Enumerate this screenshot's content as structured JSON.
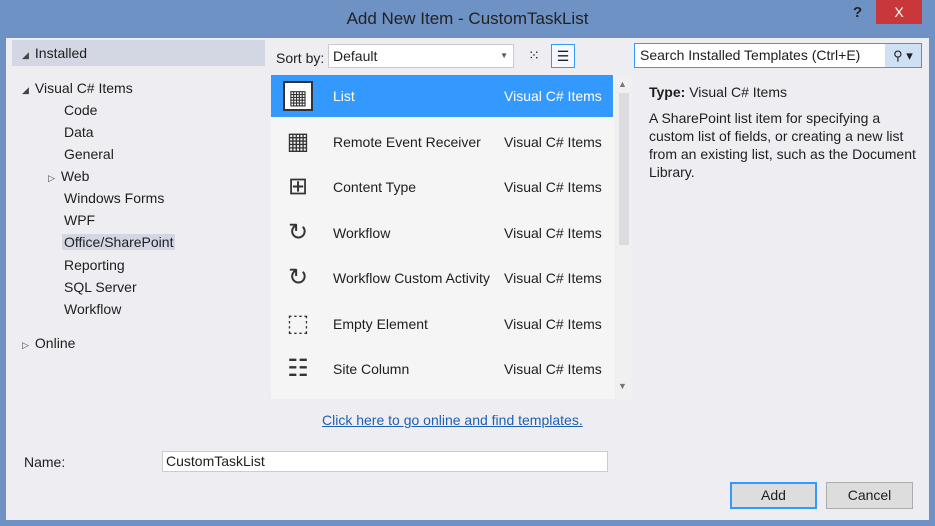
{
  "window": {
    "title": "Add New Item - CustomTaskList",
    "help": "?",
    "close": "X"
  },
  "sidebar": {
    "installed": "Installed",
    "items": [
      {
        "label": "Visual C# Items"
      },
      {
        "label": "Code"
      },
      {
        "label": "Data"
      },
      {
        "label": "General"
      },
      {
        "label": "Web"
      },
      {
        "label": "Windows Forms"
      },
      {
        "label": "WPF"
      },
      {
        "label": "Office/SharePoint"
      },
      {
        "label": "Reporting"
      },
      {
        "label": "SQL Server"
      },
      {
        "label": "Workflow"
      },
      {
        "label": "Online"
      }
    ]
  },
  "toolbar": {
    "sort_label": "Sort by:",
    "sort_value": "Default"
  },
  "search": {
    "placeholder": "Search Installed Templates (Ctrl+E)"
  },
  "templates": [
    {
      "name": "List",
      "category": "Visual C# Items",
      "icon": "list-icon"
    },
    {
      "name": "Remote Event Receiver",
      "category": "Visual C# Items",
      "icon": "remote-event-receiver-icon"
    },
    {
      "name": "Content Type",
      "category": "Visual C# Items",
      "icon": "content-type-icon"
    },
    {
      "name": "Workflow",
      "category": "Visual C# Items",
      "icon": "workflow-icon"
    },
    {
      "name": "Workflow Custom Activity",
      "category": "Visual C# Items",
      "icon": "workflow-activity-icon"
    },
    {
      "name": "Empty Element",
      "category": "Visual C# Items",
      "icon": "empty-element-icon"
    },
    {
      "name": "Site Column",
      "category": "Visual C# Items",
      "icon": "site-column-icon"
    }
  ],
  "details": {
    "type_label": "Type:",
    "type_value": "Visual C# Items",
    "description": "A SharePoint list item for specifying a custom list of fields, or creating a new list from an existing list, such as the Document Library."
  },
  "online_link": "Click here to go online and find templates.",
  "name_field": {
    "label": "Name:",
    "value": "CustomTaskList"
  },
  "buttons": {
    "add": "Add",
    "cancel": "Cancel"
  }
}
